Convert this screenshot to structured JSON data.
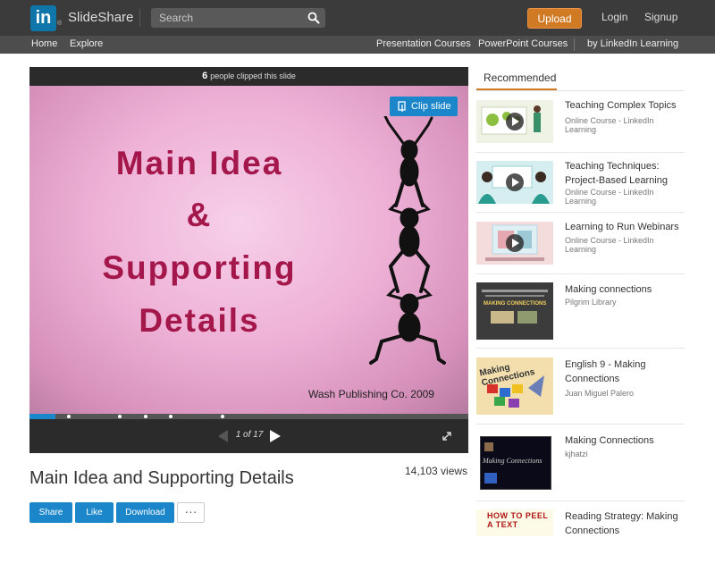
{
  "header": {
    "logo_text": "in",
    "logo_reg": "®",
    "brand": "SlideShare",
    "search_placeholder": "Search",
    "upload_label": "Upload",
    "login_label": "Login",
    "signup_label": "Signup"
  },
  "nav": {
    "home": "Home",
    "explore": "Explore",
    "presentation_courses": "Presentation Courses",
    "powerpoint_courses": "PowerPoint Courses",
    "by_linkedin": "by LinkedIn Learning"
  },
  "player": {
    "clip_count": "6",
    "clip_count_text": "people clipped this slide",
    "clip_button": "Clip slide",
    "slide_line1": "Main Idea",
    "slide_line2": "&",
    "slide_line3": "Supporting",
    "slide_line4": "Details",
    "slide_footer": "Wash Publishing Co. 2009",
    "page_indicator": "1 of 17",
    "progress_fraction": 0.06
  },
  "presentation": {
    "title": "Main Idea and Supporting Details",
    "views": "14,103 views",
    "share_label": "Share",
    "like_label": "Like",
    "download_label": "Download",
    "more_label": "···"
  },
  "recommended": {
    "tab_label": "Recommended",
    "items": [
      {
        "title": "Teaching Complex Topics",
        "subtitle": "Online Course - LinkedIn Learning"
      },
      {
        "title": "Teaching Techniques: Project-Based Learning",
        "subtitle": "Online Course - LinkedIn Learning"
      },
      {
        "title": "Learning to Run Webinars",
        "subtitle": "Online Course - LinkedIn Learning"
      },
      {
        "title": "Making connections",
        "subtitle": "Pilgrim Library",
        "thumb_text": "MAKING CONNECTIONS"
      },
      {
        "title": "English 9 - Making Connections",
        "subtitle": "Juan Miguel Palero",
        "thumb_text": "Making Connections"
      },
      {
        "title": "Making Connections",
        "subtitle": "kjhatzi",
        "thumb_text": "Making Connections"
      },
      {
        "title": "Reading Strategy: Making Connections",
        "subtitle": "",
        "thumb_text": "HOW TO PEEL A TEXT"
      }
    ]
  },
  "colors": {
    "topbar": "#3b3b3b",
    "accent_blue": "#1b86c9",
    "upload_orange": "#d07a24",
    "slide_title": "#a4174a"
  }
}
